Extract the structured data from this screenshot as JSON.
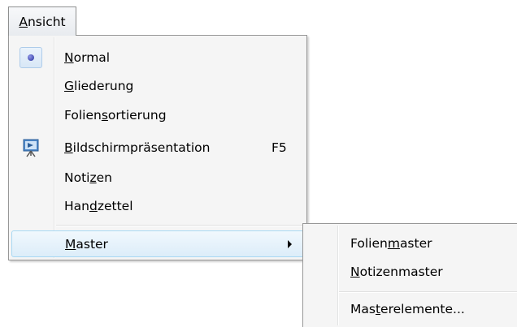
{
  "menubar": {
    "ansicht": {
      "accel": "A",
      "rest": "nsicht"
    }
  },
  "menu": {
    "items": [
      {
        "pre": "",
        "accel": "N",
        "post": "ormal",
        "checked": true,
        "icon": "radio-bullet-icon"
      },
      {
        "pre": "",
        "accel": "G",
        "post": "liederung"
      },
      {
        "pre": "Folien",
        "accel": "s",
        "post": "ortierung"
      },
      {
        "pre": "",
        "accel": "B",
        "post": "ildschirmpräsentation",
        "shortcut": "F5",
        "icon": "slideshow-projector-icon"
      },
      {
        "pre": "Noti",
        "accel": "z",
        "post": "en"
      },
      {
        "pre": "Han",
        "accel": "d",
        "post": "zettel"
      },
      {
        "pre": "",
        "accel": "M",
        "post": "aster",
        "submenu": true,
        "highlighted": true
      }
    ]
  },
  "submenu": {
    "items": [
      {
        "pre": "Folien",
        "accel": "m",
        "post": "aster"
      },
      {
        "pre": "",
        "accel": "N",
        "post": "otizenmaster"
      },
      {
        "pre": "Mas",
        "accel": "t",
        "post": "erelemente..."
      }
    ]
  },
  "colors": {
    "menu_bg": "#f5f5f5",
    "highlight_border": "#a8d8f3",
    "highlight_fill": "#dcedf9",
    "bullet": "#26309e"
  }
}
